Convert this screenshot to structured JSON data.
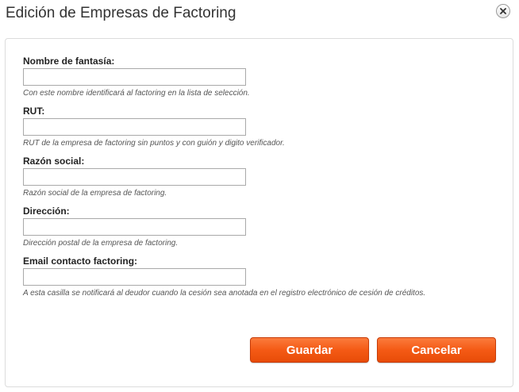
{
  "dialog": {
    "title": "Edición de Empresas de Factoring",
    "close_icon": "close-icon"
  },
  "form": {
    "fields": [
      {
        "label": "Nombre de fantasía:",
        "value": "",
        "help": "Con este nombre identificará al factoring en la lista de selección."
      },
      {
        "label": "RUT:",
        "value": "",
        "help": "RUT de la empresa de factoring sin puntos y con guión y digito verificador."
      },
      {
        "label": "Razón social:",
        "value": "",
        "help": "Razón social de la empresa de factoring."
      },
      {
        "label": "Dirección:",
        "value": "",
        "help": "Dirección postal de la empresa de factoring."
      },
      {
        "label": "Email contacto factoring:",
        "value": "",
        "help": "A esta casilla se notificará al deudor cuando la cesión sea anotada en el registro electrónico de cesión de créditos."
      }
    ]
  },
  "buttons": {
    "save_label": "Guardar",
    "cancel_label": "Cancelar"
  },
  "colors": {
    "button_accent": "#f45a15",
    "panel_border": "#dcdcdc"
  }
}
